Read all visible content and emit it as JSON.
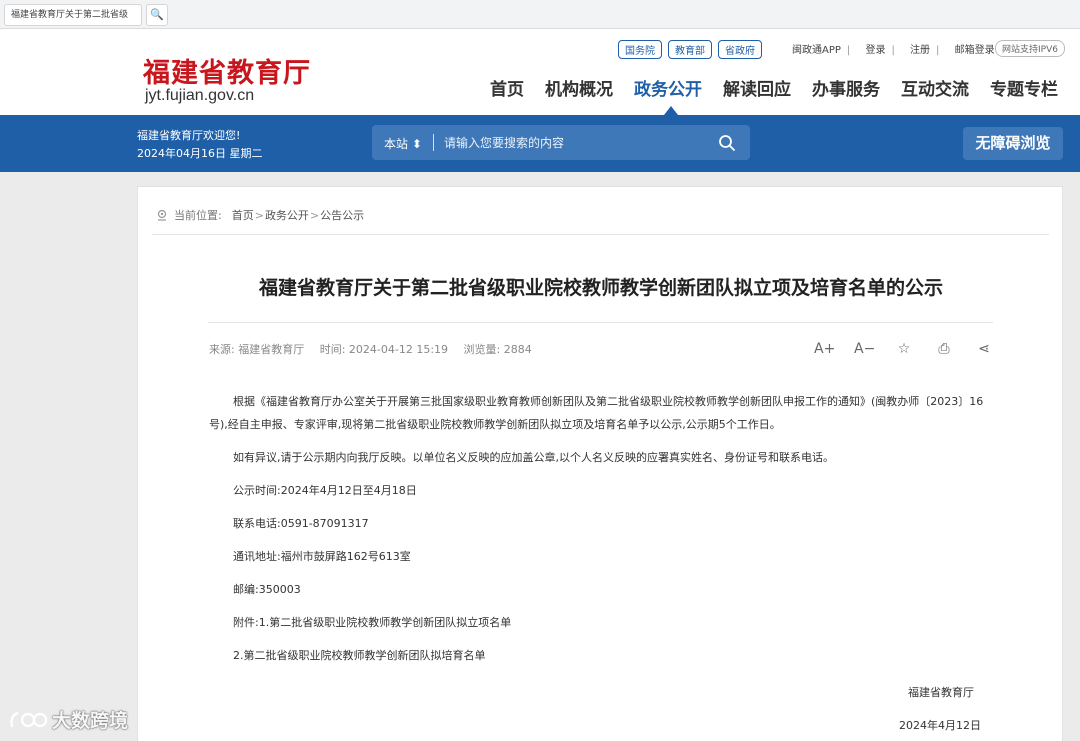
{
  "browser": {
    "tab_title": "福建省教育厅关于第二批省级",
    "search_glyph": "🔍"
  },
  "header": {
    "logo_cn": "福建省教育厅",
    "logo_en": "jyt.fujian.gov.cn",
    "quick_links": [
      "国务院",
      "教育部",
      "省政府"
    ],
    "app_link": "闽政通APP",
    "login": "登录",
    "register": "注册",
    "mail_login": "邮箱登录",
    "ipv6": "网站支持IPV6",
    "nav": [
      "首页",
      "机构概况",
      "政务公开",
      "解读回应",
      "办事服务",
      "互动交流",
      "专题专栏"
    ],
    "active_nav": "政务公开"
  },
  "banner": {
    "welcome": "福建省教育厅欢迎您!",
    "date": "2024年04月16日 星期二",
    "search_scope": "本站 ⬍",
    "search_placeholder": "请输入您要搜索的内容",
    "accessibility": "无障碍浏览"
  },
  "article": {
    "breadcrumb_prefix": "当前位置:",
    "breadcrumb": [
      "首页",
      "政务公开",
      "公告公示"
    ],
    "title": "福建省教育厅关于第二批省级职业院校教师教学创新团队拟立项及培育名单的公示",
    "source": "来源: 福建省教育厅",
    "time": "时间: 2024-04-12 15:19",
    "views": "浏览量: 2884",
    "tools": [
      "A+",
      "A−",
      "☆",
      "⎙",
      "⋖"
    ],
    "paragraphs": [
      "根据《福建省教育厅办公室关于开展第三批国家级职业教育教师创新团队及第二批省级职业院校教师教学创新团队申报工作的通知》(闽教办师〔2023〕16号),经自主申报、专家评审,现将第二批省级职业院校教师教学创新团队拟立项及培育名单予以公示,公示期5个工作日。",
      "如有异议,请于公示期内向我厅反映。以单位名义反映的应加盖公章,以个人名义反映的应署真实姓名、身份证号和联系电话。",
      "公示时间:2024年4月12日至4月18日",
      "联系电话:0591-87091317",
      "通讯地址:福州市鼓屏路162号613室",
      "邮编:350003",
      "附件:1.第二批省级职业院校教师教学创新团队拟立项名单",
      "2.第二批省级职业院校教师教学创新团队拟培育名单"
    ],
    "signature": "福建省教育厅",
    "sign_date": "2024年4月12日"
  },
  "watermark": "大数跨境",
  "colors": {
    "brand_blue": "#1f5fa8",
    "logo_red": "#c8161d"
  }
}
